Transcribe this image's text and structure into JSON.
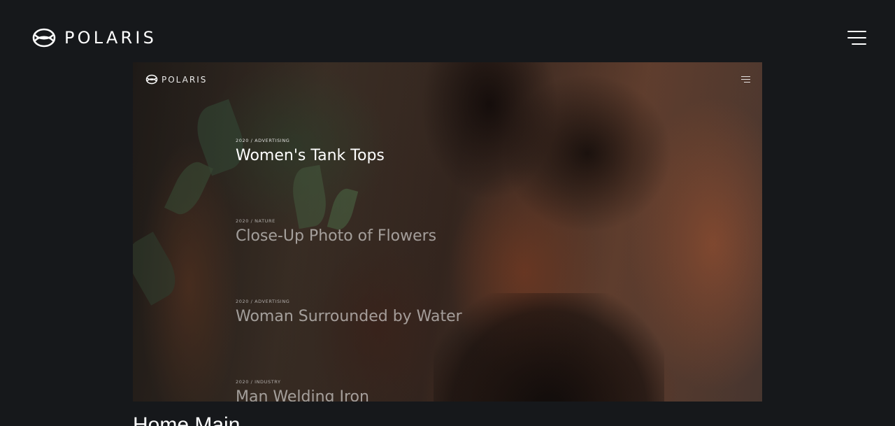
{
  "header": {
    "brand_name": "POLARIS",
    "logo_icon": "polaris-logo-icon",
    "menu_icon": "hamburger-menu-icon"
  },
  "preview": {
    "brand_name": "POLARIS",
    "logo_icon": "polaris-logo-icon",
    "menu_icon": "hamburger-menu-icon",
    "items": [
      {
        "meta": "2020 / ADVERTISING",
        "title": "Women's Tank Tops",
        "emphasis": "active"
      },
      {
        "meta": "2020 / NATURE",
        "title": "Close-Up Photo of Flowers",
        "emphasis": "dim"
      },
      {
        "meta": "2020 / ADVERTISING",
        "title": "Woman Surrounded by Water",
        "emphasis": "dim"
      },
      {
        "meta": "2020 / INDUSTRY",
        "title": "Man Welding Iron",
        "emphasis": "dim"
      }
    ]
  },
  "caption": "Home Main",
  "colors": {
    "background": "#16181b",
    "text": "#ffffff"
  }
}
